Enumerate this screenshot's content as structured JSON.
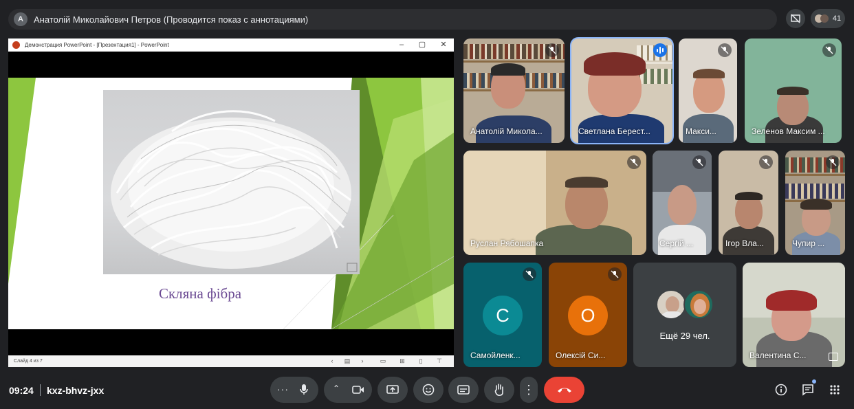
{
  "presenter_bar": {
    "avatar_letter": "A",
    "title": "Анатолій Миколайович Петров (Проводится показ с аннотациями)"
  },
  "participant_count": "41",
  "presentation": {
    "window_title": "Демонстрация PowerPoint - [Презентация1] - PowerPoint",
    "slide_caption": "Скляна фібра",
    "slide_status": "Слайд 4 из 7"
  },
  "participants": [
    {
      "name": "Анатолій Микола...",
      "muted": true
    },
    {
      "name": "Светлана Берест...",
      "speaking": true
    },
    {
      "name": "Макси...",
      "muted": true
    },
    {
      "name": "Зеленов Максим ...",
      "muted": true
    },
    {
      "name": "Руслан Рябошапка",
      "muted": true
    },
    {
      "name": "Сергій ...",
      "muted": true
    },
    {
      "name": "Ігор Вла...",
      "muted": true
    },
    {
      "name": "Чупир ...",
      "muted": true
    },
    {
      "name": "Самойленк...",
      "initial": "С",
      "muted": true
    },
    {
      "name": "Олексій Си...",
      "initial": "О",
      "muted": true
    },
    {
      "name": "Валентина С..."
    }
  ],
  "more_participants": "Ещё 29 чел.",
  "footer": {
    "time": "09:24",
    "meeting_code": "kxz-bhvz-jxx"
  },
  "colors": {
    "background": "#202124",
    "tile": "#3c4043",
    "hangup": "#ea4335",
    "avatar_teal": "#0b8a94",
    "avatar_orange": "#e8710a",
    "slide_green": "#8dc63f",
    "caption_purple": "#6b4a93"
  },
  "icons": {
    "mic": "mic-icon",
    "camera": "camera-icon",
    "present": "present-screen-icon",
    "emoji": "emoji-icon",
    "captions": "captions-icon",
    "hand": "raise-hand-icon",
    "more": "more-vert-icon",
    "hangup": "hangup-icon",
    "info": "info-icon",
    "chat": "chat-icon",
    "apps": "apps-grid-icon"
  }
}
